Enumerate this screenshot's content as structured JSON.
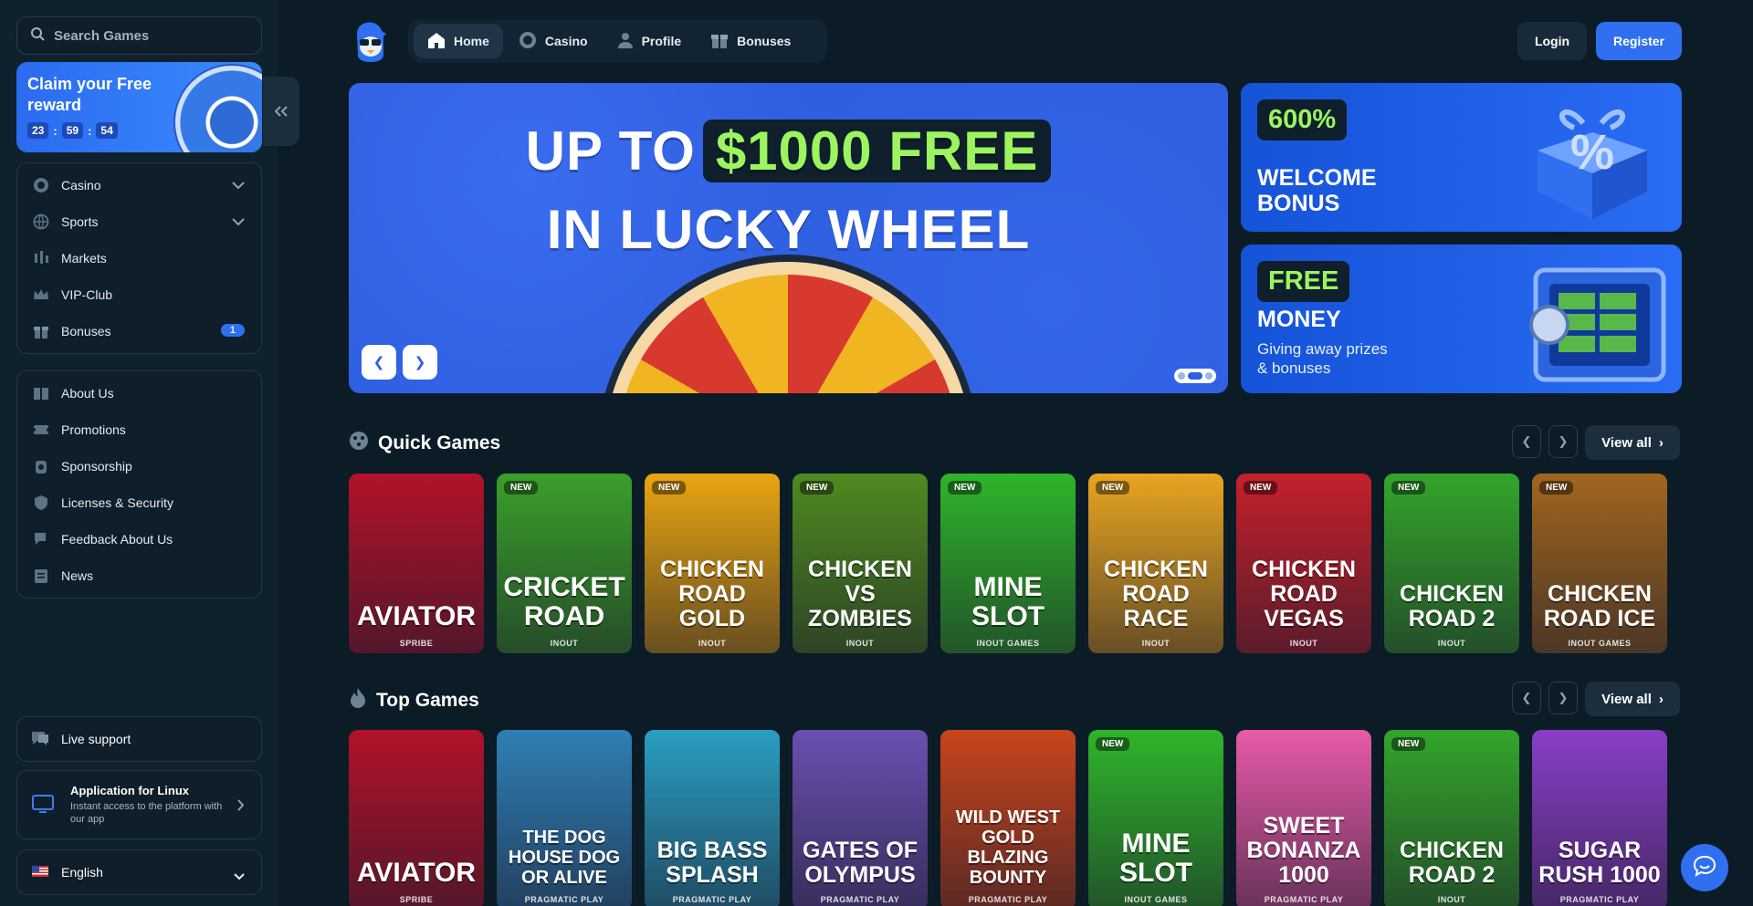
{
  "sidebar": {
    "search_placeholder": "Search Games",
    "claim": {
      "title": "Claim your Free reward",
      "timer": [
        "23",
        "59",
        "54"
      ]
    },
    "menu": [
      {
        "label": "Casino",
        "icon": "casino-chip-icon",
        "chevron": true
      },
      {
        "label": "Sports",
        "icon": "globe-icon",
        "chevron": true
      },
      {
        "label": "Markets",
        "icon": "markets-icon"
      },
      {
        "label": "VIP-Club",
        "icon": "crown-icon"
      },
      {
        "label": "Bonuses",
        "icon": "gift-icon",
        "badge": "1"
      }
    ],
    "info": [
      {
        "label": "About Us",
        "icon": "book-icon"
      },
      {
        "label": "Promotions",
        "icon": "ticket-icon"
      },
      {
        "label": "Sponsorship",
        "icon": "sponsor-icon"
      },
      {
        "label": "Licenses & Security",
        "icon": "shield-icon"
      },
      {
        "label": "Feedback About Us",
        "icon": "feedback-icon"
      },
      {
        "label": "News",
        "icon": "news-icon"
      }
    ],
    "live_support": "Live support",
    "app": {
      "title": "Application for Linux",
      "subtitle": "Instant access to the platform with our app"
    },
    "language": "English"
  },
  "topnav": {
    "items": [
      {
        "label": "Home",
        "icon": "home-icon",
        "active": true
      },
      {
        "label": "Casino",
        "icon": "casino-chip-icon"
      },
      {
        "label": "Profile",
        "icon": "user-icon"
      },
      {
        "label": "Bonuses",
        "icon": "gift-icon"
      }
    ],
    "login": "Login",
    "register": "Register"
  },
  "hero": {
    "line1_prefix": "UP TO",
    "line1_highlight": "$1000 FREE",
    "line2": "IN LUCKY WHEEL"
  },
  "promos": [
    {
      "tag": "600%",
      "title": "WELCOME BONUS",
      "subtitle": ""
    },
    {
      "tag": "FREE",
      "title": "MONEY",
      "subtitle": "Giving away prizes & bonuses"
    }
  ],
  "sections": [
    {
      "title": "Quick Games",
      "icon": "dice-icon",
      "view_all": "View all",
      "games": [
        {
          "name": "AVIATOR",
          "provider": "SPRIBE",
          "new": false,
          "color": "#b3122a"
        },
        {
          "name": "CRICKET ROAD",
          "provider": "INOUT",
          "new": true,
          "color": "#3aa02a"
        },
        {
          "name": "CHICKEN ROAD GOLD",
          "provider": "INOUT",
          "new": true,
          "color": "#e9a511"
        },
        {
          "name": "CHICKEN VS ZOMBIES",
          "provider": "INOUT",
          "new": true,
          "color": "#4f8a20"
        },
        {
          "name": "MINE SLOT",
          "provider": "INOUT GAMES",
          "new": true,
          "color": "#2fb52a"
        },
        {
          "name": "CHICKEN ROAD RACE",
          "provider": "INOUT",
          "new": true,
          "color": "#e8a520"
        },
        {
          "name": "CHICKEN ROAD VEGAS",
          "provider": "INOUT",
          "new": true,
          "color": "#c5202c"
        },
        {
          "name": "CHICKEN ROAD 2",
          "provider": "INOUT",
          "new": true,
          "color": "#33a62a"
        },
        {
          "name": "CHICKEN ROAD ICE",
          "provider": "INOUT GAMES",
          "new": true,
          "color": "#a0661f"
        }
      ]
    },
    {
      "title": "Top Games",
      "icon": "flame-icon",
      "view_all": "View all",
      "games": [
        {
          "name": "AVIATOR",
          "provider": "SPRIBE",
          "new": false,
          "color": "#b3122a"
        },
        {
          "name": "THE DOG HOUSE DOG OR ALIVE",
          "provider": "PRAGMATIC PLAY",
          "new": false,
          "color": "#2f7fb5"
        },
        {
          "name": "BIG BASS SPLASH",
          "provider": "PRAGMATIC PLAY",
          "new": false,
          "color": "#2a9ec2"
        },
        {
          "name": "GATES OF OLYMPUS",
          "provider": "PRAGMATIC PLAY",
          "new": false,
          "color": "#6a4fb0"
        },
        {
          "name": "WILD WEST GOLD BLAZING BOUNTY",
          "provider": "PRAGMATIC PLAY",
          "new": false,
          "color": "#c8441c"
        },
        {
          "name": "MINE SLOT",
          "provider": "INOUT GAMES",
          "new": true,
          "color": "#2fb52a"
        },
        {
          "name": "SWEET BONANZA 1000",
          "provider": "PRAGMATIC PLAY",
          "new": false,
          "color": "#e85aa8"
        },
        {
          "name": "CHICKEN ROAD 2",
          "provider": "INOUT",
          "new": true,
          "color": "#33a62a"
        },
        {
          "name": "SUGAR RUSH 1000",
          "provider": "PRAGMATIC PLAY",
          "new": false,
          "color": "#8a3ec8"
        }
      ]
    }
  ],
  "colors": {
    "accent": "#2f6ff0",
    "highlight": "#9cf55f",
    "background": "#0b1c27",
    "sidebar": "#10212e"
  }
}
